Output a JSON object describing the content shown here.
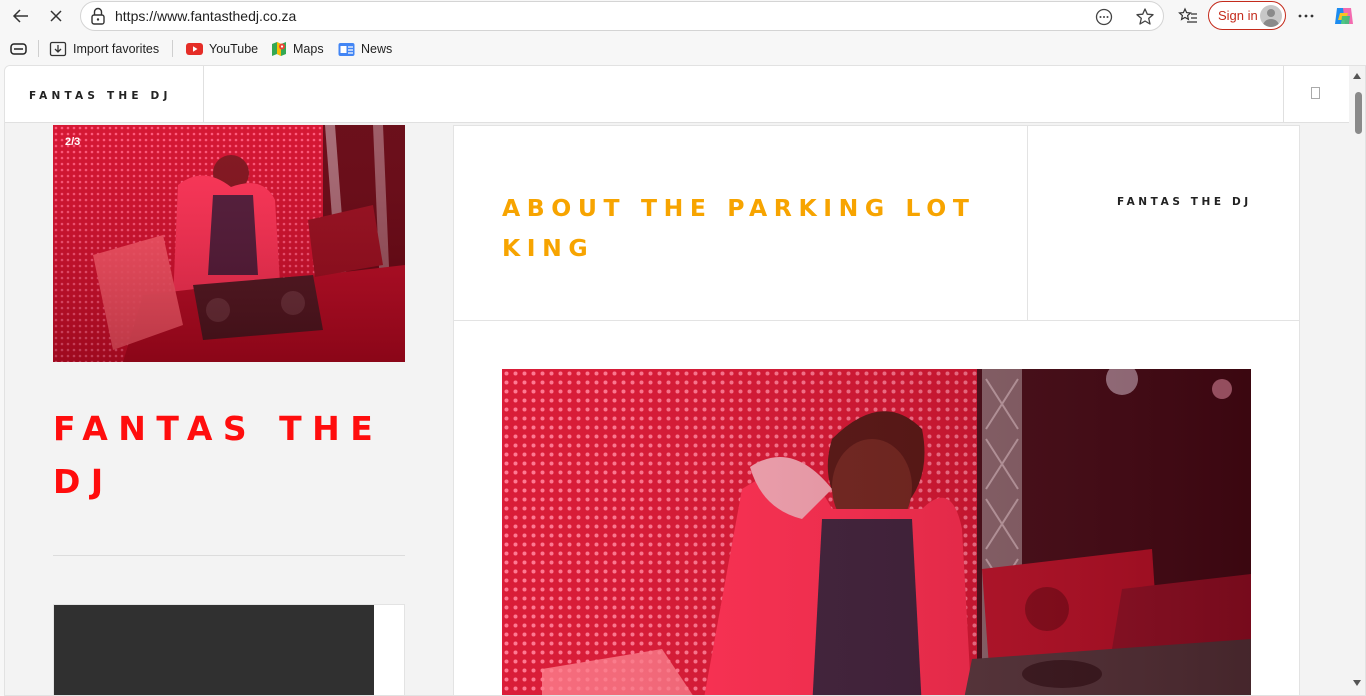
{
  "browser": {
    "url": "https://www.fantasthedj.co.za",
    "sign_in": "Sign in",
    "bookmarks": [
      {
        "label": "Import favorites",
        "icon": "import-favorites-icon"
      },
      {
        "label": "YouTube",
        "icon": "youtube-icon"
      },
      {
        "label": "Maps",
        "icon": "maps-icon"
      },
      {
        "label": "News",
        "icon": "news-icon"
      }
    ]
  },
  "site": {
    "brand": "FANTAS THE DJ",
    "title": "FANTAS THE DJ",
    "slide_counter": "2/3"
  },
  "post": {
    "title": "ABOUT THE PARKING LOT KING",
    "author": "FANTAS THE DJ"
  },
  "colors": {
    "site_title": "#ff0d0d",
    "post_title": "#f7a400",
    "sign_in": "#c42b1c"
  }
}
